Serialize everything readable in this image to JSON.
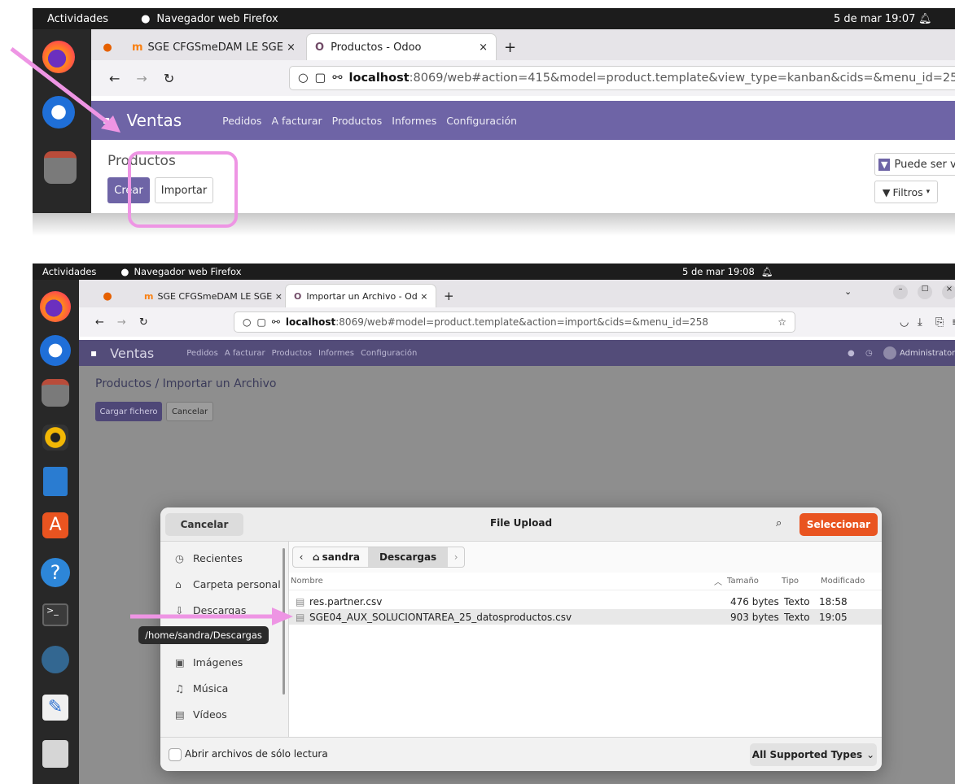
{
  "shot1": {
    "topbar": {
      "activities": "Actividades",
      "app_name": "Navegador web Firefox",
      "clock": "5 de mar  19:07"
    },
    "tabs": [
      {
        "label": "SGE CFGSmeDAM LE SGE ×"
      },
      {
        "label": "Productos - Odoo",
        "close": "×"
      }
    ],
    "new_tab": "+",
    "url": {
      "host": "localhost",
      "path": ":8069/web#action=415&model=product.template&view_type=kanban&cids=&menu_id=25"
    },
    "odoo": {
      "app": "Ventas",
      "menu": [
        "Pedidos",
        "A facturar",
        "Productos",
        "Informes",
        "Configuración"
      ]
    },
    "page_title": "Productos",
    "create_label": "Crear",
    "import_label": "Importar",
    "search_facet": "Puede ser v",
    "filters_label": "Filtros"
  },
  "shot2": {
    "topbar": {
      "activities": "Actividades",
      "app_name": "Navegador web Firefox",
      "clock": "5 de mar  19:08"
    },
    "tabs": [
      {
        "label": "SGE CFGSmeDAM LE SGE ×"
      },
      {
        "label": "Importar un Archivo - Od ×"
      }
    ],
    "new_tab": "+",
    "url": {
      "host": "localhost",
      "path": ":8069/web#model=product.template&action=import&cids=&menu_id=258"
    },
    "odoo": {
      "app": "Ventas",
      "menu": [
        "Pedidos",
        "A facturar",
        "Productos",
        "Informes",
        "Configuración"
      ],
      "user": "Administrator"
    },
    "breadcrumb": "Productos / Importar un Archivo",
    "load_file_label": "Cargar fichero",
    "cancel_label": "Cancelar",
    "dialog": {
      "cancel": "Cancelar",
      "title": "File Upload",
      "select": "Seleccionar",
      "path": [
        "sandra",
        "Descargas"
      ],
      "sidebar": [
        "Recientes",
        "Carpeta personal",
        "Descargas",
        "Imágenes",
        "Música",
        "Vídeos"
      ],
      "tooltip": "/home/sandra/Descargas",
      "columns": {
        "name": "Nombre",
        "size": "Tamaño",
        "type": "Tipo",
        "modified": "Modificado"
      },
      "files": [
        {
          "name": "res.partner.csv",
          "size": "476 bytes",
          "type": "Texto",
          "modified": "18:58"
        },
        {
          "name": "SGE04_AUX_SOLUCIONTAREA_25_datosproductos.csv",
          "size": "903 bytes",
          "type": "Texto",
          "modified": "19:05"
        }
      ],
      "readonly_label": "Abrir archivos de sólo lectura",
      "filter_label": "All Supported Types"
    }
  },
  "colors": {
    "odoo_purple": "#6e64a6",
    "accent_orange": "#e95420",
    "annotation_pink": "#ee95e4"
  }
}
